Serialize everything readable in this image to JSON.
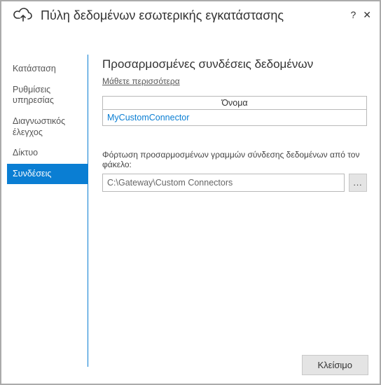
{
  "window": {
    "title": "Πύλη δεδομένων εσωτερικής εγκατάστασης",
    "help_symbol": "?",
    "close_symbol": "✕"
  },
  "sidebar": {
    "items": [
      {
        "label": "Κατάσταση",
        "selected": false
      },
      {
        "label": "Ρυθμίσεις υπηρεσίας",
        "selected": false
      },
      {
        "label": "Διαγνωστικός έλεγχος",
        "selected": false
      },
      {
        "label": "Δίκτυο",
        "selected": false
      },
      {
        "label": "Συνδέσεις",
        "selected": true
      }
    ]
  },
  "main": {
    "heading": "Προσαρμοσμένες συνδέσεις δεδομένων",
    "learn_more": "Μάθετε περισσότερα",
    "table": {
      "header": "Όνομα",
      "rows": [
        "MyCustomConnector"
      ]
    },
    "load_label": "Φόρτωση προσαρμοσμένων γραμμών σύνδεσης δεδομένων από τον φάκελο:",
    "path_value": "C:\\Gateway\\Custom Connectors",
    "browse_label": "..."
  },
  "footer": {
    "close_label": "Κλείσιμο"
  }
}
